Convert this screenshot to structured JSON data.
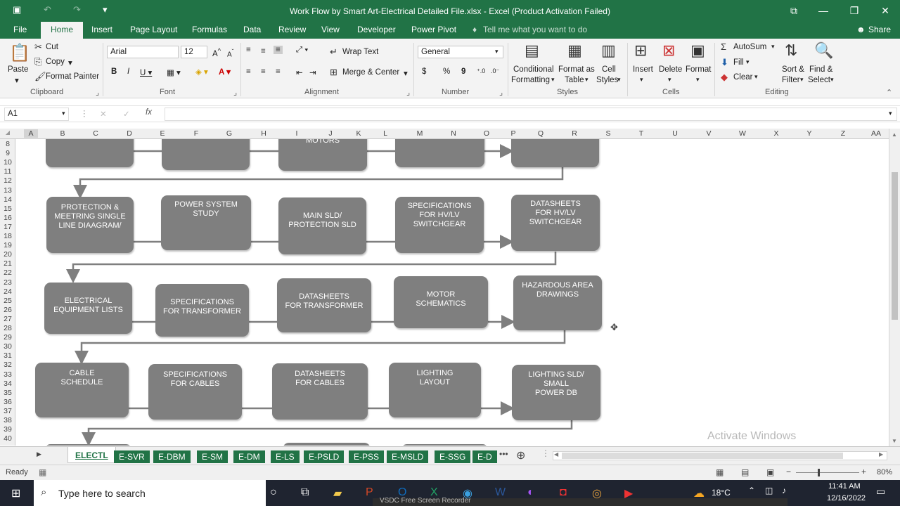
{
  "window": {
    "title": "Work Flow by Smart Art-Electrical Detailed File.xlsx  -  Excel (Product Activation Failed)"
  },
  "tabs": [
    "File",
    "Home",
    "Insert",
    "Page Layout",
    "Formulas",
    "Data",
    "Review",
    "View",
    "Developer",
    "Power Pivot"
  ],
  "tellme": "Tell me what you want to do",
  "share": "Share",
  "ribbon": {
    "clipboard": {
      "paste": "Paste",
      "cut": "Cut",
      "copy": "Copy",
      "format_painter": "Format Painter",
      "label": "Clipboard"
    },
    "font": {
      "name": "Arial",
      "size": "12",
      "label": "Font"
    },
    "alignment": {
      "wrap": "Wrap Text",
      "merge": "Merge & Center",
      "label": "Alignment"
    },
    "number": {
      "format": "General",
      "label": "Number",
      "currency": "$",
      "percent": "%",
      "comma": "9"
    },
    "styles": {
      "cond1": "Conditional",
      "cond2": "Formatting",
      "fmt1": "Format as",
      "fmt2": "Table",
      "cell1": "Cell",
      "cell2": "Styles",
      "label": "Styles"
    },
    "cells": {
      "insert": "Insert",
      "delete": "Delete",
      "format": "Format",
      "label": "Cells"
    },
    "editing": {
      "autosum": "AutoSum",
      "fill": "Fill",
      "clear": "Clear",
      "sort1": "Sort &",
      "sort2": "Filter",
      "find1": "Find &",
      "find2": "Select",
      "label": "Editing"
    }
  },
  "formula_bar": {
    "namebox": "A1",
    "fx": "fx",
    "value": ""
  },
  "columns": [
    "A",
    "B",
    "C",
    "D",
    "E",
    "F",
    "G",
    "H",
    "I",
    "J",
    "K",
    "L",
    "M",
    "N",
    "O",
    "P",
    "Q",
    "R",
    "S",
    "T",
    "U",
    "V",
    "W",
    "X",
    "Y",
    "Z",
    "AA"
  ],
  "rows": [
    "8",
    "9",
    "10",
    "11",
    "12",
    "13",
    "14",
    "15",
    "16",
    "17",
    "18",
    "19",
    "20",
    "21",
    "22",
    "23",
    "24",
    "25",
    "26",
    "27",
    "28",
    "29",
    "30",
    "31",
    "32",
    "33",
    "34",
    "35",
    "36",
    "37",
    "38",
    "39",
    "40"
  ],
  "flow_nodes": [
    "MOTORS",
    "PROTECTION &\nMEETRING SINGLE\nLINE DIAAGRAM/",
    "POWER SYSTEM\nSTUDY",
    "MAIN SLD/\nPROTECTION SLD",
    "SPECIFICATIONS\nFOR HV/LV\nSWITCHGEAR",
    "DATASHEETS\nFOR HV/LV\nSWITCHGEAR",
    "ELECTRICAL\nEQUIPMENT LISTS",
    "SPECIFICATIONS\nFOR TRANSFORMER",
    "DATASHEETS\nFOR TRANSFORMER",
    "MOTOR\nSCHEMATICS",
    "HAZARDOUS AREA\nDRAWINGS",
    "CABLE\nSCHEDULE",
    "SPECIFICATIONS\nFOR CABLES",
    "DATASHEETS\nFOR CABLES",
    "LIGHTING\nLAYOUT",
    "LIGHTING SLD/\nSMALL\nPOWER DB"
  ],
  "watermark": "Activate Windows",
  "sheets": [
    "ELECTL",
    "E-SVR",
    "E-DBM",
    "E-SM",
    "E-DM",
    "E-LS",
    "E-PSLD",
    "E-PSS",
    "E-MSLD",
    "E-SSG",
    "E-D"
  ],
  "status": {
    "ready": "Ready",
    "zoom": "80%"
  },
  "taskbar": {
    "search": "Type here to search",
    "temp": "18°C",
    "time": "11:41 AM",
    "date": "12/16/2022",
    "recorder": "VSDC Free Screen Recorder"
  },
  "colors": {
    "excel_green": "#217346",
    "node_gray": "#7f7f7f"
  }
}
